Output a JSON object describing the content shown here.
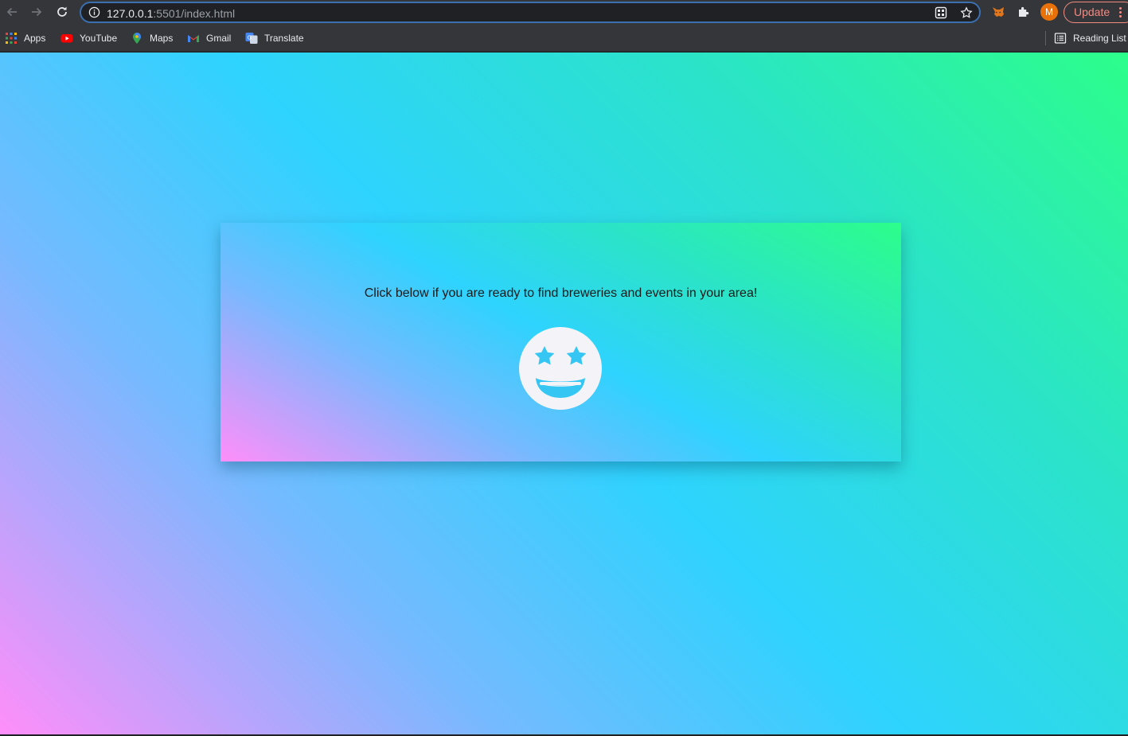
{
  "browser": {
    "url_host": "127.0.0.1",
    "url_rest": ":5501/index.html",
    "avatar_initial": "M",
    "update_label": "Update",
    "icons": [
      "back-arrow-icon",
      "forward-arrow-icon",
      "reload-icon",
      "info-icon",
      "qr-code-icon",
      "star-icon",
      "metamask-icon",
      "extensions-puzzle-icon"
    ]
  },
  "bookmarks": {
    "items": [
      {
        "label": "Apps",
        "icon": "apps-grid-icon"
      },
      {
        "label": "YouTube",
        "icon": "youtube-icon"
      },
      {
        "label": "Maps",
        "icon": "maps-pin-icon"
      },
      {
        "label": "Gmail",
        "icon": "gmail-icon"
      },
      {
        "label": "Translate",
        "icon": "translate-icon"
      }
    ],
    "reading_list": "Reading List"
  },
  "page": {
    "card_text": "Click below if you are ready to find breweries and events in your area!",
    "emoji": "grin-stars-icon",
    "colors": {
      "gradient_pink": "#ff8ef9",
      "gradient_cyan": "#2ed3fe",
      "gradient_green": "#2cfe8a",
      "emoji_fill": "#f4f4f8"
    }
  }
}
